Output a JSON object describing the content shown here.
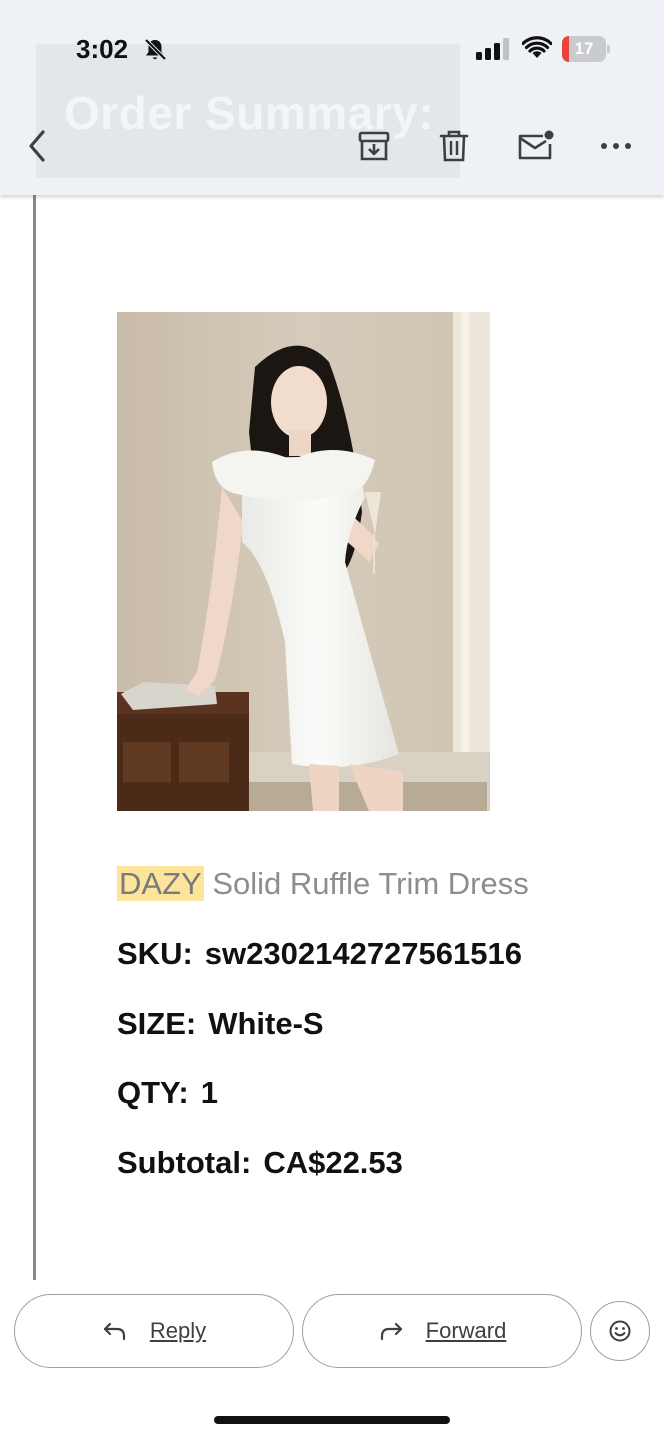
{
  "status_bar": {
    "time": "3:02",
    "battery_level": "17",
    "battery_fraction": 0.17,
    "icons": [
      "bell-slash-icon",
      "cellular-signal-icon",
      "wifi-icon",
      "battery-icon"
    ]
  },
  "header": {
    "ghost_title": "Order Summary:",
    "actions": [
      "back-icon",
      "archive-icon",
      "trash-icon",
      "mark-unread-icon",
      "more-icon"
    ]
  },
  "product": {
    "brand": "DAZY",
    "name": "Solid Ruffle Trim Dress",
    "sku_label": "SKU:",
    "sku_value": "sw2302142727561516",
    "size_label": "SIZE:",
    "size_value": "White-S",
    "qty_label": "QTY:",
    "qty_value": "1",
    "subtotal_label": "Subtotal:",
    "subtotal_value": "CA$22.53"
  },
  "footer": {
    "reply_label": "Reply",
    "forward_label": "Forward",
    "emoji_icon": "smiley-icon"
  },
  "colors": {
    "header_bg": "#eef1f5",
    "brand_highlight": "#fde49b",
    "battery_low": "#e5453b",
    "text": "#111111",
    "muted_text": "#8d8d8d"
  }
}
